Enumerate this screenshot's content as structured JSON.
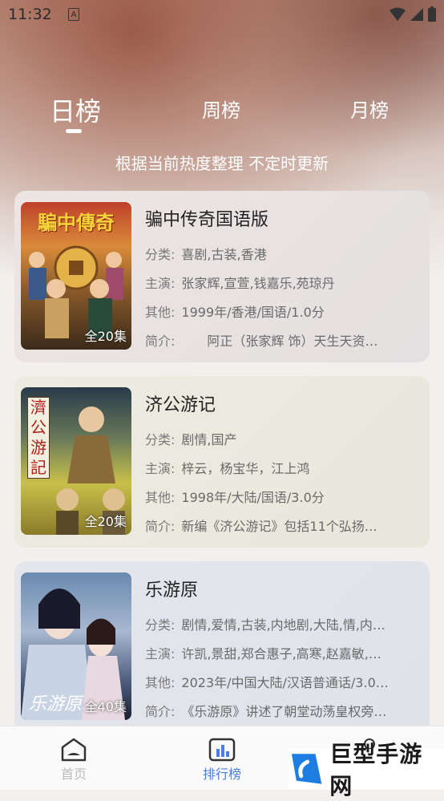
{
  "status_bar": {
    "time": "11:32",
    "notification_glyph": "A"
  },
  "tabs": [
    {
      "label": "日榜",
      "active": true
    },
    {
      "label": "周榜",
      "active": false
    },
    {
      "label": "月榜",
      "active": false
    }
  ],
  "subtitle": "根据当前热度整理 不定时更新",
  "labels": {
    "category": "分类:",
    "cast": "主演:",
    "other": "其他:",
    "intro": "简介:"
  },
  "items": [
    {
      "title": "骗中传奇国语版",
      "category": "喜剧,古装,香港",
      "cast": "张家辉,宣萱,钱嘉乐,苑琼丹",
      "other": "1999年/香港/国语/1.0分",
      "intro": "　　阿正（张家辉 饰）天生天资…",
      "episodes": "全20集",
      "poster_text": "騙中傳奇"
    },
    {
      "title": "济公游记",
      "category": "剧情,国产",
      "cast": "梓云，杨宝华，江上鸿",
      "other": "1998年/大陆/国语/3.0分",
      "intro": "新编《济公游记》包括11个弘扬…",
      "episodes": "全20集",
      "poster_text": "濟公游記"
    },
    {
      "title": "乐游原",
      "category": "剧情,爱情,古装,内地剧,大陆,情,内…",
      "cast": "许凯,景甜,郑合惠子,高寒,赵嘉敏,…",
      "other": "2023年/中国大陆/汉语普通话/3.0…",
      "intro": "《乐游原》讲述了朝堂动荡皇权旁…",
      "episodes": "全40集",
      "poster_text": "乐游原"
    }
  ],
  "bottom_nav": [
    {
      "label": "首页",
      "icon": "home-icon",
      "active": false
    },
    {
      "label": "排行榜",
      "icon": "ranking-icon",
      "active": true
    },
    {
      "label": "",
      "icon": "profile-icon",
      "active": false
    }
  ],
  "watermark": {
    "text": "巨型手游网"
  },
  "colors": {
    "accent": "#4a7de8",
    "inactive": "#bbbbbb"
  }
}
